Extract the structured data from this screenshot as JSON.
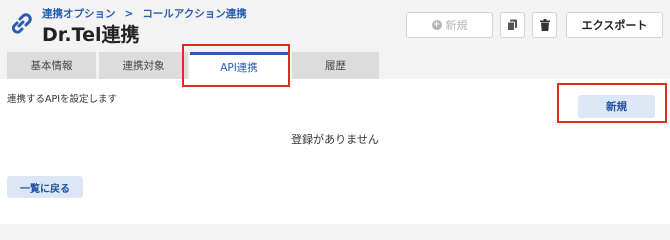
{
  "header": {
    "breadcrumb": [
      "連携オプション",
      "コールアクション連携"
    ],
    "breadcrumb_separator": ">",
    "title": "Dr.Tel連携",
    "link_icon": "link-icon"
  },
  "toolbar": {
    "new_label": "新規",
    "copy_icon": "copy-icon",
    "trash_icon": "trash-icon",
    "export_label": "エクスポート"
  },
  "tabs": [
    {
      "label": "基本情報",
      "active": false
    },
    {
      "label": "連携対象",
      "active": false
    },
    {
      "label": "API連携",
      "active": true
    },
    {
      "label": "履歴",
      "active": false
    }
  ],
  "content": {
    "description": "連携するAPIを設定します",
    "new_button_label": "新規",
    "empty_message": "登録がありません",
    "back_button_label": "一覧に戻る"
  },
  "colors": {
    "accent": "#2a5db0",
    "highlight": "#e02a1d",
    "button_light": "#dce6f5"
  }
}
